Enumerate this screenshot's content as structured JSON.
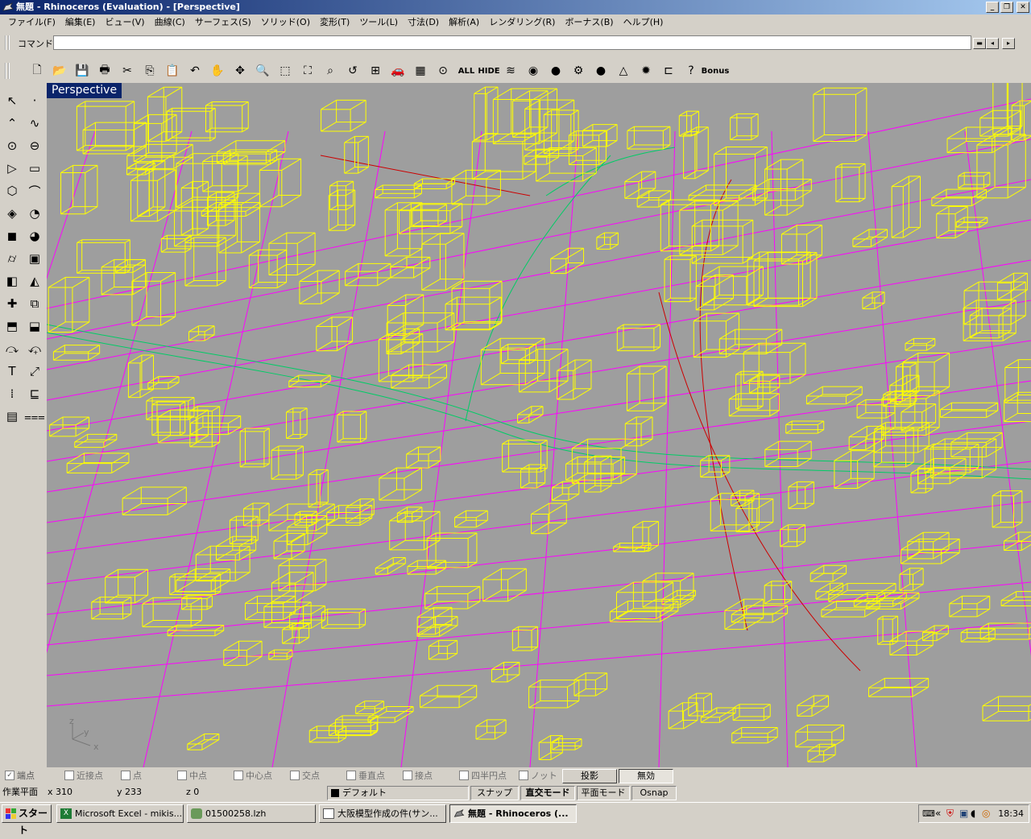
{
  "window": {
    "title": "無題 - Rhinoceros (Evaluation) - [Perspective]",
    "buttons": [
      "_",
      "❐",
      "✕"
    ]
  },
  "menu": [
    "ファイル(F)",
    "編集(E)",
    "ビュー(V)",
    "曲線(C)",
    "サーフェス(S)",
    "ソリッド(O)",
    "変形(T)",
    "ツール(L)",
    "寸法(D)",
    "解析(A)",
    "レンダリング(R)",
    "ボーナス(B)",
    "ヘルプ(H)"
  ],
  "command": {
    "label": "コマンド:",
    "value": ""
  },
  "toolbar": {
    "all_label": "ALL",
    "hide_label": "HIDE",
    "bonus_label": "Bonus"
  },
  "viewport": {
    "title": "Perspective",
    "axis_x": "x",
    "axis_y": "y",
    "axis_z": "z"
  },
  "osnap": {
    "items": [
      {
        "label": "端点",
        "checked": true
      },
      {
        "label": "近接点",
        "checked": false
      },
      {
        "label": "点",
        "checked": false
      },
      {
        "label": "中点",
        "checked": false
      },
      {
        "label": "中心点",
        "checked": false
      },
      {
        "label": "交点",
        "checked": false
      },
      {
        "label": "垂直点",
        "checked": false
      },
      {
        "label": "接点",
        "checked": false
      },
      {
        "label": "四半円点",
        "checked": false
      },
      {
        "label": "ノット",
        "checked": false
      }
    ],
    "project_label": "投影",
    "disable_label": "無効"
  },
  "status": {
    "cplane": "作業平面",
    "x": "x 310",
    "y": "y 233",
    "z": "z 0",
    "layer": "デフォルト",
    "snap": "スナップ",
    "ortho": "直交モード",
    "planar": "平面モード",
    "osnap": "Osnap"
  },
  "taskbar": {
    "start": "スタート",
    "tasks": [
      {
        "label": "Microsoft Excel - mikis..."
      },
      {
        "label": "01500258.lzh"
      },
      {
        "label": "大阪模型作成の件(サン..."
      },
      {
        "label": "無題 - Rhinoceros (..."
      }
    ],
    "clock": "18:34"
  },
  "colors": {
    "buildings": "#ffff00",
    "roads": "#ff00ff",
    "rail": "#00cc66",
    "river": "#cc0000",
    "viewport_bg": "#9e9e9e"
  }
}
